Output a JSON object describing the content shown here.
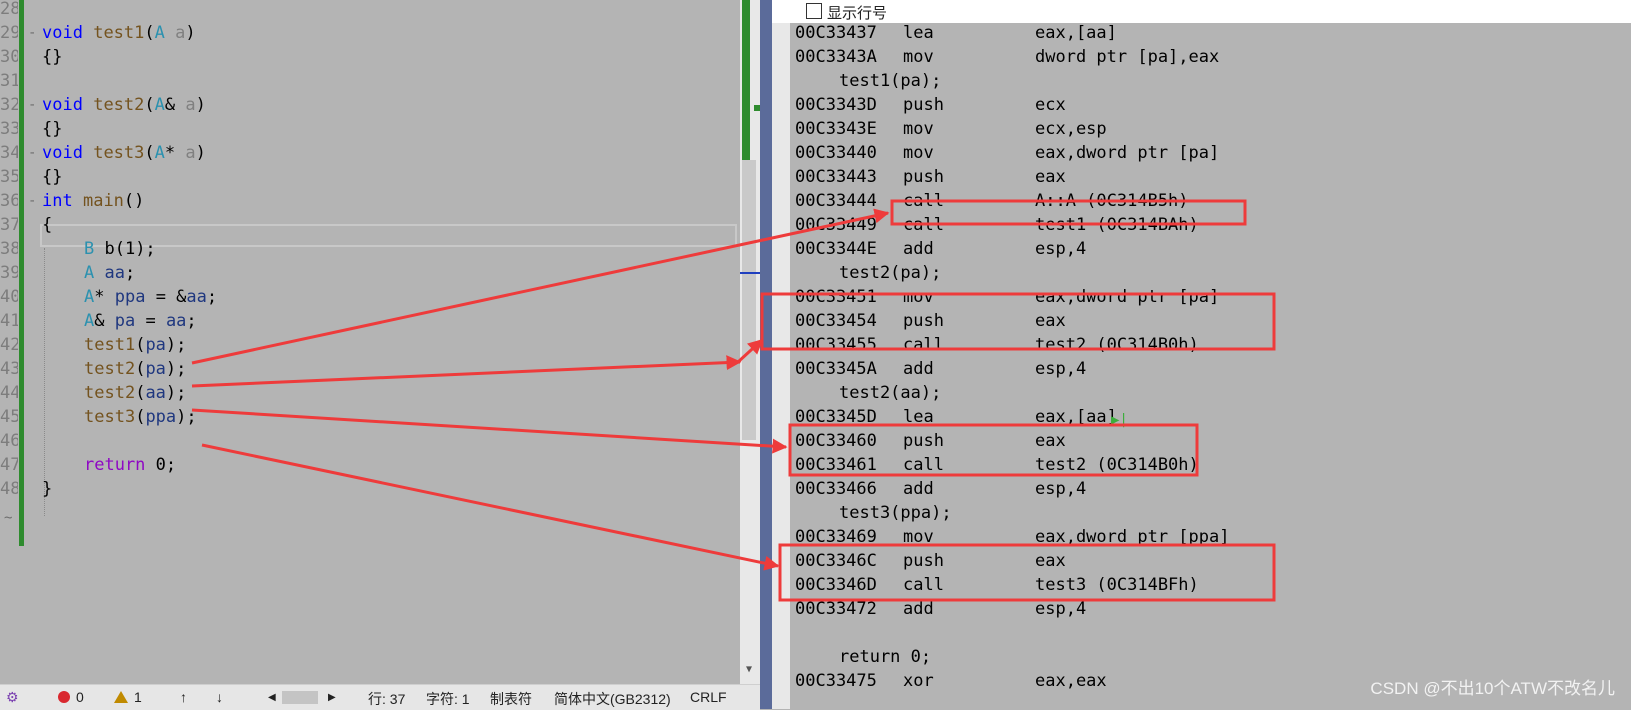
{
  "editor": {
    "line_numbers": [
      "28",
      "29",
      "30",
      "31",
      "32",
      "33",
      "34",
      "35",
      "36",
      "37",
      "38",
      "39",
      "40",
      "41",
      "42",
      "43",
      "44",
      "45",
      "46",
      "47",
      "48"
    ],
    "lines": {
      "l29": {
        "kw": "void",
        "fn": "test1",
        "p1": "(",
        "ty": "A",
        "p2": " ",
        "pm": "a",
        "p3": ")"
      },
      "l30": "{}",
      "l32": {
        "kw": "void",
        "fn": "test2",
        "p1": "(",
        "ty": "A",
        "p2": "& ",
        "pm": "a",
        "p3": ")"
      },
      "l33": "{}",
      "l34": {
        "kw": "void",
        "fn": "test3",
        "p1": "(",
        "ty": "A",
        "p2": "* ",
        "pm": "a",
        "p3": ")"
      },
      "l35": "{}",
      "l36": {
        "kw": "int",
        "fn": "main",
        "p1": "()"
      },
      "l37": "{",
      "l38": {
        "ty": "B",
        "rest": " b(1);"
      },
      "l39": {
        "ty": "A",
        "vr": " aa",
        "rest": ";"
      },
      "l40": {
        "ty": "A",
        "a": "* ",
        "vr": "ppa",
        "b": " = &",
        "vr2": "aa",
        "rest": ";"
      },
      "l41": {
        "ty": "A",
        "a": "& ",
        "vr": "pa",
        "b": " = ",
        "vr2": "aa",
        "rest": ";"
      },
      "l42": {
        "fn": "test1",
        "a": "(",
        "vr": "pa",
        "rest": ");"
      },
      "l43": {
        "fn": "test2",
        "a": "(",
        "vr": "pa",
        "rest": ");"
      },
      "l44": {
        "fn": "test2",
        "a": "(",
        "vr": "aa",
        "rest": ");"
      },
      "l45": {
        "fn": "test3",
        "a": "(",
        "vr": "ppa",
        "rest": ");"
      },
      "l47": {
        "kw": "return",
        "rest": " 0;"
      },
      "l48": "}"
    },
    "fold_marker": "-",
    "end_marker": "~"
  },
  "status_bar": {
    "errors": "0",
    "warnings": "1",
    "up": "↑",
    "down": "↓",
    "left": "◀",
    "right": "▶",
    "line": "行: 37",
    "char": "字符: 1",
    "indent": "制表符",
    "encoding": "简体中文(GB2312)",
    "eol": "CRLF"
  },
  "disassembly": {
    "show_line_numbers_label": "显示行号",
    "rows": [
      {
        "addr": "00C33437",
        "op": "lea",
        "args": "eax,[aa]"
      },
      {
        "addr": "00C3343A",
        "op": "mov",
        "args": "dword ptr [pa],eax"
      },
      {
        "src": "test1(pa);"
      },
      {
        "addr": "00C3343D",
        "op": "push",
        "args": "ecx"
      },
      {
        "addr": "00C3343E",
        "op": "mov",
        "args": "ecx,esp"
      },
      {
        "addr": "00C33440",
        "op": "mov",
        "args": "eax,dword ptr [pa]"
      },
      {
        "addr": "00C33443",
        "op": "push",
        "args": "eax"
      },
      {
        "addr": "00C33444",
        "op": "call",
        "args": "A::A (0C314B5h)"
      },
      {
        "addr": "00C33449",
        "op": "call",
        "args": "test1 (0C314BAh)"
      },
      {
        "addr": "00C3344E",
        "op": "add",
        "args": "esp,4"
      },
      {
        "src": "test2(pa);"
      },
      {
        "addr": "00C33451",
        "op": "mov",
        "args": "eax,dword ptr [pa]"
      },
      {
        "addr": "00C33454",
        "op": "push",
        "args": "eax"
      },
      {
        "addr": "00C33455",
        "op": "call",
        "args": "test2 (0C314B0h)"
      },
      {
        "addr": "00C3345A",
        "op": "add",
        "args": "esp,4"
      },
      {
        "src": "test2(aa);"
      },
      {
        "addr": "00C3345D",
        "op": "lea",
        "args": "eax,[aa]"
      },
      {
        "addr": "00C33460",
        "op": "push",
        "args": "eax"
      },
      {
        "addr": "00C33461",
        "op": "call",
        "args": "test2 (0C314B0h)"
      },
      {
        "addr": "00C33466",
        "op": "add",
        "args": "esp,4"
      },
      {
        "src": "test3(ppa);"
      },
      {
        "addr": "00C33469",
        "op": "mov",
        "args": "eax,dword ptr [ppa]"
      },
      {
        "addr": "00C3346C",
        "op": "push",
        "args": "eax"
      },
      {
        "addr": "00C3346D",
        "op": "call",
        "args": "test3 (0C314BFh)"
      },
      {
        "addr": "00C33472",
        "op": "add",
        "args": "esp,4"
      },
      {
        "src": ""
      },
      {
        "src": "return 0;"
      },
      {
        "addr": "00C33475",
        "op": "xor",
        "args": "eax,eax"
      }
    ],
    "play_icon": "▶|"
  },
  "watermark": "CSDN @不出10个ATW不改名儿",
  "colors": {
    "annotation": "#ee3b3b",
    "keyword": "#0000ff",
    "function": "#74531f",
    "type": "#2b91af",
    "variable": "#1f377f",
    "return_kw": "#8f08c4",
    "gutter_green": "#2e8b2e"
  }
}
